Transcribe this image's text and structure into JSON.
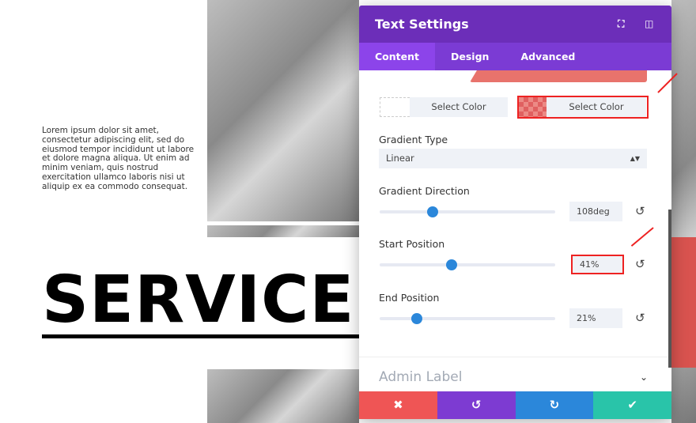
{
  "page": {
    "lorem": "Lorem ipsum dolor sit amet, consectetur adipiscing elit, sed do eiusmod tempor incididunt ut labore et dolore magna aliqua. Ut enim ad minim veniam, quis nostrud exercitation ullamco laboris nisi ut aliquip ex ea commodo consequat.",
    "heading": "SERVICES"
  },
  "panel": {
    "title": "Text Settings",
    "tabs": [
      {
        "label": "Content",
        "active": true
      },
      {
        "label": "Design"
      },
      {
        "label": "Advanced"
      }
    ],
    "color1_label": "Select Color",
    "color2_label": "Select Color",
    "gradient_type": {
      "label": "Gradient Type",
      "value": "Linear"
    },
    "gradient_direction": {
      "label": "Gradient Direction",
      "value": "108deg",
      "fraction": 0.3
    },
    "start_position": {
      "label": "Start Position",
      "value": "41%",
      "fraction": 0.41
    },
    "end_position": {
      "label": "End Position",
      "value": "21%",
      "fraction": 0.21
    },
    "admin_label": "Admin Label",
    "gradient_color": "#e8736c",
    "footer_colors": {
      "cancel": "#ef5555",
      "undo": "#7d3bd2",
      "redo": "#2b87da",
      "save": "#29c4a9"
    }
  }
}
